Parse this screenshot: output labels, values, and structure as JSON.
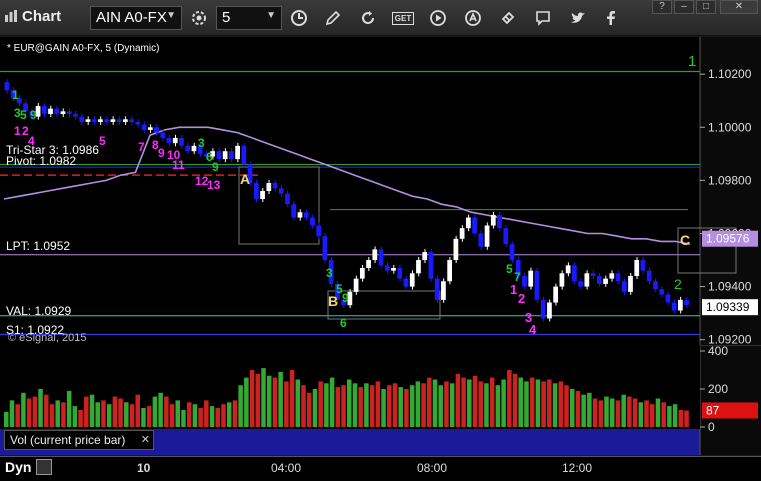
{
  "toolbar": {
    "title": "Chart",
    "symbol": "AIN A0-FX",
    "interval": "5",
    "icons": [
      "settings-icon",
      "clock-icon",
      "pencil-icon",
      "refresh-icon",
      "get-icon",
      "play-icon",
      "alert-icon",
      "link-icon",
      "comment-icon",
      "twitter-icon",
      "facebook-icon"
    ],
    "get_label": "GET"
  },
  "window_controls": [
    "?",
    "–",
    "□",
    "✕"
  ],
  "pane": {
    "title": "* EUR@GAIN A0-FX, 5 (Dynamic)",
    "copyright": "© eSignal, 2015"
  },
  "labels": {
    "tristar": "Tri-Star 3: 1.0986",
    "pivot": "Pivot: 1.0982",
    "lpt": "LPT: 1.0952",
    "val": "VAL: 1.0929",
    "s1": "S1: 1.0922",
    "marker_a": "A",
    "marker_b": "B",
    "marker_c": "C",
    "green_1": "1",
    "green_2": "2",
    "magenta_1": "1",
    "magenta_2": "2",
    "magenta_3": "3",
    "magenta_4": "4"
  },
  "price_axis": {
    "ticks": [
      "1.10200",
      "1.10000",
      "1.09800",
      "1.09600",
      "1.09400",
      "1.09200"
    ],
    "current_price": "1.09339",
    "ma_value": "1.09576"
  },
  "volume": {
    "caption": "Vol (current price bar)",
    "close_label": "✕",
    "axis_ticks": [
      "400",
      "200",
      "0"
    ],
    "current": "87"
  },
  "time_axis": {
    "label": "Dyn",
    "ticks": [
      "10",
      "04:00",
      "08:00",
      "12:00"
    ]
  },
  "colors": {
    "background": "#000000",
    "bar_up": "#ffffff",
    "bar_down": "#1a1aff",
    "ma_line": "#b58ee0",
    "green_level": "#2aa02a",
    "red_dashed": "#e02020",
    "magenta_count": "#ff2bff",
    "green_count": "#22cc22",
    "marker": "#f5d76e",
    "vol_red": "#cc2222",
    "vol_green": "#33aa33",
    "vol_bg": "#1b1b9a"
  },
  "chart_data": {
    "type": "line",
    "price_range": [
      1.0918,
      1.1034
    ],
    "levels": {
      "tristar": 1.0986,
      "pivot": 1.0982,
      "lpt": 1.0952,
      "val": 1.0929,
      "s1": 1.0922,
      "resistance_top": 1.1021,
      "green_mid": 1.0969,
      "purple_mid": 1.0985
    },
    "price_series": [
      1.1014,
      1.1011,
      1.1009,
      1.1006,
      1.1004,
      1.1008,
      1.1005,
      1.1007,
      1.1005,
      1.1006,
      1.1005,
      1.1004,
      1.1002,
      1.1003,
      1.1002,
      1.1003,
      1.1002,
      1.1003,
      1.1002,
      1.1003,
      1.1002,
      1.1001,
      1.0999,
      1.1,
      1.0998,
      1.0996,
      1.0994,
      1.0996,
      1.0993,
      1.0991,
      1.0993,
      1.099,
      1.0989,
      1.0991,
      1.0988,
      1.0991,
      1.0988,
      1.0993,
      1.0986,
      1.0979,
      1.0973,
      1.0976,
      1.0979,
      1.0977,
      1.0975,
      1.0971,
      1.0966,
      1.0968,
      1.0966,
      1.0963,
      1.0959,
      1.095,
      1.0941,
      1.0935,
      1.0933,
      1.0938,
      1.0943,
      1.0947,
      1.095,
      1.0954,
      1.0948,
      1.0946,
      1.0947,
      1.0943,
      1.094,
      1.0945,
      1.095,
      1.0953,
      1.0943,
      1.0935,
      1.0942,
      1.095,
      1.0958,
      1.0962,
      1.0966,
      1.096,
      1.0955,
      1.0963,
      1.0967,
      1.0962,
      1.0956,
      1.095,
      1.0944,
      1.094,
      1.0946,
      1.0935,
      1.0928,
      1.0934,
      1.094,
      1.0945,
      1.0948,
      1.0942,
      1.094,
      1.0945,
      1.0944,
      1.0941,
      1.0943,
      1.0945,
      1.0942,
      1.0938,
      1.0944,
      1.095,
      1.0946,
      1.0942,
      1.0939,
      1.0937,
      1.0934,
      1.0931,
      1.0935,
      1.0933
    ],
    "ma_series": [
      1.0973,
      1.0974,
      1.0975,
      1.0976,
      1.0977,
      1.0978,
      1.0979,
      1.098,
      1.0982,
      1.0983,
      1.0997,
      1.0999,
      1.1,
      1.1,
      1.1,
      1.0999,
      1.0998,
      1.0996,
      1.0994,
      1.0992,
      1.099,
      1.0988,
      1.0986,
      1.0984,
      1.0982,
      1.098,
      1.0978,
      1.0976,
      1.0974,
      1.0973,
      1.0971,
      1.097,
      1.0968,
      1.0967,
      1.0966,
      1.0965,
      1.0964,
      1.0963,
      1.0962,
      1.0961,
      1.096,
      1.096,
      1.0959,
      1.0958,
      1.0958,
      1.0957,
      1.0957,
      1.0956
    ],
    "volume": [
      80,
      140,
      120,
      180,
      150,
      160,
      200,
      170,
      120,
      140,
      130,
      190,
      110,
      90,
      160,
      170,
      130,
      140,
      120,
      160,
      150,
      130,
      120,
      170,
      100,
      110,
      160,
      180,
      160,
      120,
      140,
      90,
      130,
      120,
      100,
      140,
      110,
      100,
      120,
      130,
      140,
      220,
      260,
      300,
      280,
      310,
      270,
      260,
      290,
      240,
      300,
      250,
      220,
      180,
      200,
      240,
      230,
      260,
      210,
      220,
      250,
      230,
      210,
      230,
      220,
      240,
      200,
      220,
      230,
      210,
      200,
      220,
      240,
      230,
      260,
      250,
      220,
      240,
      230,
      280,
      260,
      250,
      270,
      240,
      230,
      260,
      220,
      250,
      300,
      280,
      260,
      240,
      260,
      250,
      240,
      250,
      230,
      240,
      220,
      200,
      190,
      170,
      180,
      150,
      140,
      160,
      150,
      140,
      170,
      160,
      150,
      130,
      140,
      120,
      150,
      130,
      110,
      120,
      90,
      87
    ],
    "volume_axis": [
      0,
      400
    ]
  }
}
